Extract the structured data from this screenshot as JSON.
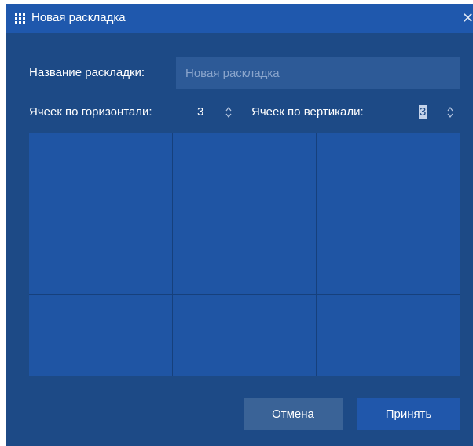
{
  "window": {
    "title": "Новая раскладка",
    "title_icon": "grid-icon",
    "close_icon": "close-icon"
  },
  "form": {
    "name_label": "Название раскладки:",
    "name_placeholder": "Новая раскладка",
    "name_value": "",
    "cols_label": "Ячеек по горизонтали:",
    "cols_value": "3",
    "rows_label": "Ячеек по вертикали:",
    "rows_value": "3"
  },
  "layout_preview": {
    "columns": 3,
    "rows": 3
  },
  "buttons": {
    "cancel": "Отмена",
    "accept": "Принять"
  },
  "colors": {
    "dialog_background": "#1d4a86",
    "titlebar": "#1f58ad",
    "cell": "#1f55a4",
    "cancel_button": "#3a6397",
    "accept_button": "#2057ab"
  }
}
